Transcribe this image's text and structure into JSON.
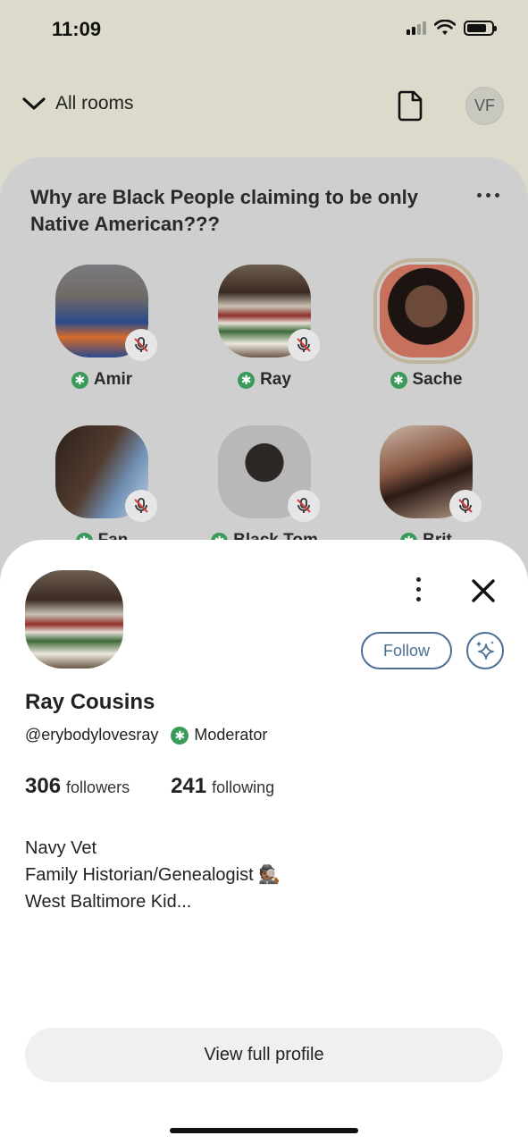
{
  "status_bar": {
    "time": "11:09"
  },
  "nav": {
    "rooms_label": "All rooms",
    "avatar_initials": "VF"
  },
  "room": {
    "title": "Why are Black People claiming to be only Native American???",
    "speakers": [
      {
        "name": "Amir",
        "moderator": true,
        "muted": true
      },
      {
        "name": "Ray",
        "moderator": true,
        "muted": true
      },
      {
        "name": "Sache",
        "moderator": true,
        "muted": false,
        "speaking": true
      },
      {
        "name": "Fan",
        "moderator": true,
        "muted": true
      },
      {
        "name": "Black Tom",
        "moderator": true,
        "muted": true
      },
      {
        "name": "Brit",
        "moderator": true,
        "muted": true
      }
    ]
  },
  "profile": {
    "name": "Ray Cousins",
    "handle": "@erybodylovesray",
    "role_badge": "Moderator",
    "followers_count": "306",
    "followers_label": "followers",
    "following_count": "241",
    "following_label": "following",
    "bio": [
      "Navy Vet",
      "Family Historian/Genealogist 🕵🏾",
      "West Baltimore Kid..."
    ],
    "follow_label": "Follow",
    "view_full_profile_label": "View full profile"
  },
  "colors": {
    "accent": "#4c6f93",
    "moderator_green": "#3a9a5a"
  }
}
